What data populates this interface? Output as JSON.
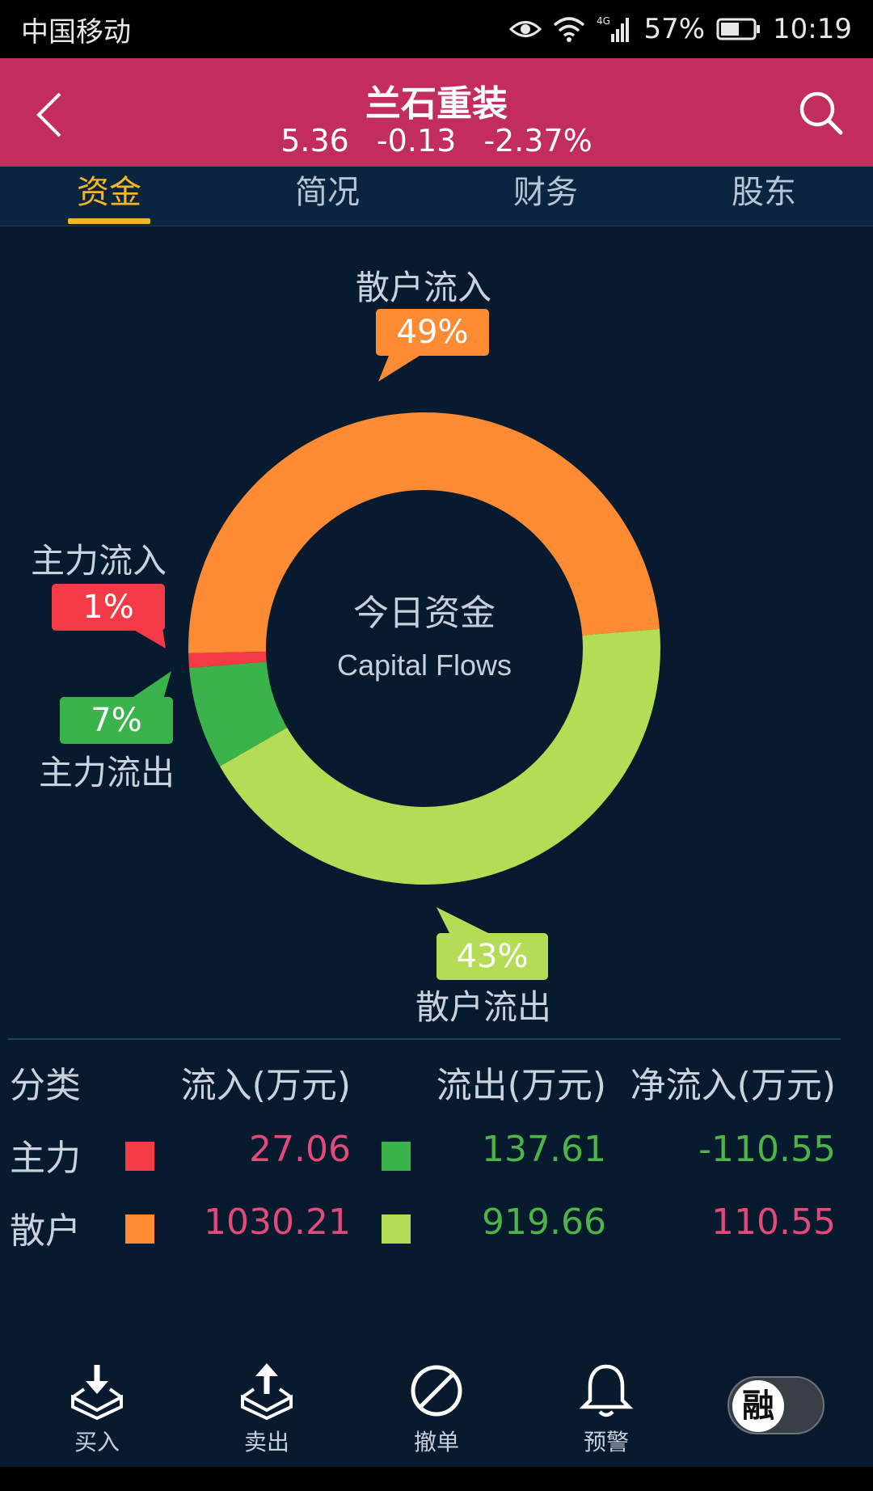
{
  "status_bar": {
    "carrier": "中国移动",
    "network": "4G",
    "battery": "57%",
    "time": "10:19"
  },
  "header": {
    "title": "兰石重装",
    "price": "5.36",
    "change": "-0.13",
    "change_pct": "-2.37%"
  },
  "tabs": [
    {
      "label": "资金",
      "active": true
    },
    {
      "label": "简况",
      "active": false
    },
    {
      "label": "财务",
      "active": false
    },
    {
      "label": "股东",
      "active": false
    }
  ],
  "chart_data": {
    "type": "pie",
    "center_title": "今日资金",
    "center_subtitle": "Capital Flows",
    "slices": [
      {
        "label": "散户流入",
        "value": 49,
        "display": "49%",
        "color": "#fd8b34"
      },
      {
        "label": "散户流出",
        "value": 43,
        "display": "43%",
        "color": "#b4dd55"
      },
      {
        "label": "主力流出",
        "value": 7,
        "display": "7%",
        "color": "#3ab44a"
      },
      {
        "label": "主力流入",
        "value": 1,
        "display": "1%",
        "color": "#f53a47"
      }
    ]
  },
  "table": {
    "headers": [
      "分类",
      "流入(万元)",
      "流出(万元)",
      "净流入(万元)"
    ],
    "rows": [
      {
        "category": "主力",
        "inflow": "27.06",
        "inflow_color": "#f53a47",
        "outflow": "137.61",
        "outflow_color": "#3ab44a",
        "net": "-110.55",
        "net_color": "#4fb448"
      },
      {
        "category": "散户",
        "inflow": "1030.21",
        "inflow_color": "#fd8b34",
        "outflow": "919.66",
        "outflow_color": "#b4dd55",
        "net": "110.55",
        "net_color": "#e24a7a"
      }
    ]
  },
  "bottom_bar": [
    {
      "label": "买入",
      "icon": "buy-tray-icon"
    },
    {
      "label": "卖出",
      "icon": "sell-tray-icon"
    },
    {
      "label": "撤单",
      "icon": "cancel-order-icon"
    },
    {
      "label": "预警",
      "icon": "bell-icon"
    }
  ],
  "margin_toggle": {
    "label": "融"
  }
}
